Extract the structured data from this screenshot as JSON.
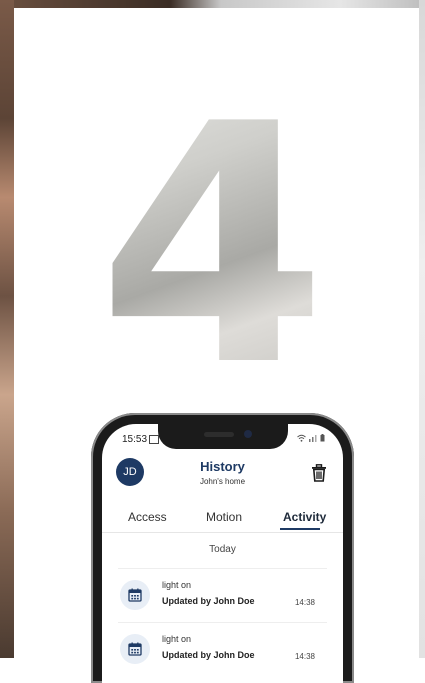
{
  "hero": {
    "number": "4"
  },
  "status_bar": {
    "time": "15:53"
  },
  "header": {
    "avatar_initials": "JD",
    "title": "History",
    "subtitle": "John's home"
  },
  "tabs": [
    {
      "label": "Access"
    },
    {
      "label": "Motion"
    },
    {
      "label": "Activity",
      "active": true
    }
  ],
  "section_label": "Today",
  "items": [
    {
      "event": "light on",
      "updated_by": "Updated by John Doe",
      "time": "14:38"
    },
    {
      "event": "light on",
      "updated_by": "Updated by John Doe",
      "time": "14:38"
    }
  ],
  "colors": {
    "accent": "#1e3a64"
  }
}
